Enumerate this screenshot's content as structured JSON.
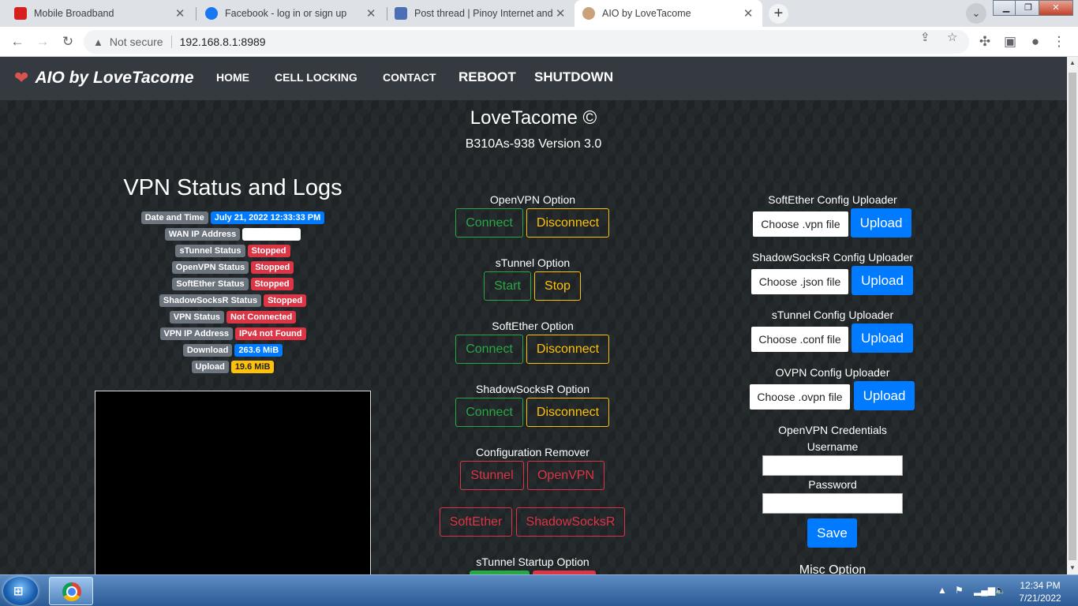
{
  "browser": {
    "tabs": [
      {
        "title": "Mobile Broadband",
        "favicon_color": "#d7201d"
      },
      {
        "title": "Facebook - log in or sign up",
        "favicon_color": "#1877f2"
      },
      {
        "title": "Post thread | Pinoy Internet and T",
        "favicon_color": "#4a6fb5"
      },
      {
        "title": "AIO by LoveTacome",
        "favicon_color": "#c9a27a",
        "active": true
      }
    ],
    "tab_close_glyph": "✕",
    "new_tab_glyph": "+",
    "security_label": "Not secure",
    "url": "192.168.8.1:8989"
  },
  "nav": {
    "brand": "AIO by LoveTacome",
    "links": [
      "HOME",
      "CELL LOCKING",
      "CONTACT",
      "REBOOT",
      "SHUTDOWN"
    ]
  },
  "header": {
    "title": "LoveTacome ©",
    "subtitle": "B310As-938 Version 3.0"
  },
  "status": {
    "heading": "VPN Status and Logs",
    "rows": [
      {
        "label": "Date and Time",
        "value": "July 21, 2022 12:33:33 PM",
        "color": "blue"
      },
      {
        "label": "WAN IP Address",
        "value": "",
        "color": "white"
      },
      {
        "label": "sTunnel Status",
        "value": "Stopped",
        "color": "red"
      },
      {
        "label": "OpenVPN Status",
        "value": "Stopped",
        "color": "red"
      },
      {
        "label": "SoftEther Status",
        "value": "Stopped",
        "color": "red"
      },
      {
        "label": "ShadowSocksR Status",
        "value": "Stopped",
        "color": "red"
      },
      {
        "label": "VPN Status",
        "value": "Not Connected",
        "color": "red"
      },
      {
        "label": "VPN IP Address",
        "value": "IPv4 not Found",
        "color": "red"
      },
      {
        "label": "Download",
        "value": "263.6 MiB",
        "color": "blue"
      },
      {
        "label": "Upload",
        "value": "19.6 MiB",
        "color": "yellow"
      }
    ]
  },
  "options": {
    "openvpn": {
      "label": "OpenVPN Option",
      "connect": "Connect",
      "disconnect": "Disconnect"
    },
    "stunnel": {
      "label": "sTunnel Option",
      "start": "Start",
      "stop": "Stop"
    },
    "softether": {
      "label": "SoftEther Option",
      "connect": "Connect",
      "disconnect": "Disconnect"
    },
    "shadowsocksr": {
      "label": "ShadowSocksR Option",
      "connect": "Connect",
      "disconnect": "Disconnect"
    },
    "remover": {
      "label": "Configuration Remover",
      "buttons": [
        "Stunnel",
        "OpenVPN",
        "SoftEther",
        "ShadowSocksR"
      ]
    },
    "startup": {
      "label": "sTunnel Startup Option"
    }
  },
  "uploaders": [
    {
      "label": "SoftEther Config Uploader",
      "choose": "Choose .vpn file",
      "upload": "Upload"
    },
    {
      "label": "ShadowSocksR Config Uploader",
      "choose": "Choose .json file",
      "upload": "Upload"
    },
    {
      "label": "sTunnel Config Uploader",
      "choose": "Choose .conf file",
      "upload": "Upload"
    },
    {
      "label": "OVPN Config Uploader",
      "choose": "Choose .ovpn file",
      "upload": "Upload"
    }
  ],
  "credentials": {
    "heading": "OpenVPN Credentials",
    "username_label": "Username",
    "username_value": "",
    "password_label": "Password",
    "password_value": "",
    "save": "Save"
  },
  "misc": {
    "label": "Misc Option"
  },
  "taskbar": {
    "time": "12:34 PM",
    "date": "7/21/2022"
  },
  "colors": {
    "navbar": "#343a40",
    "success": "#28a745",
    "warning": "#ffc107",
    "danger": "#dc3545",
    "primary": "#007bff"
  }
}
